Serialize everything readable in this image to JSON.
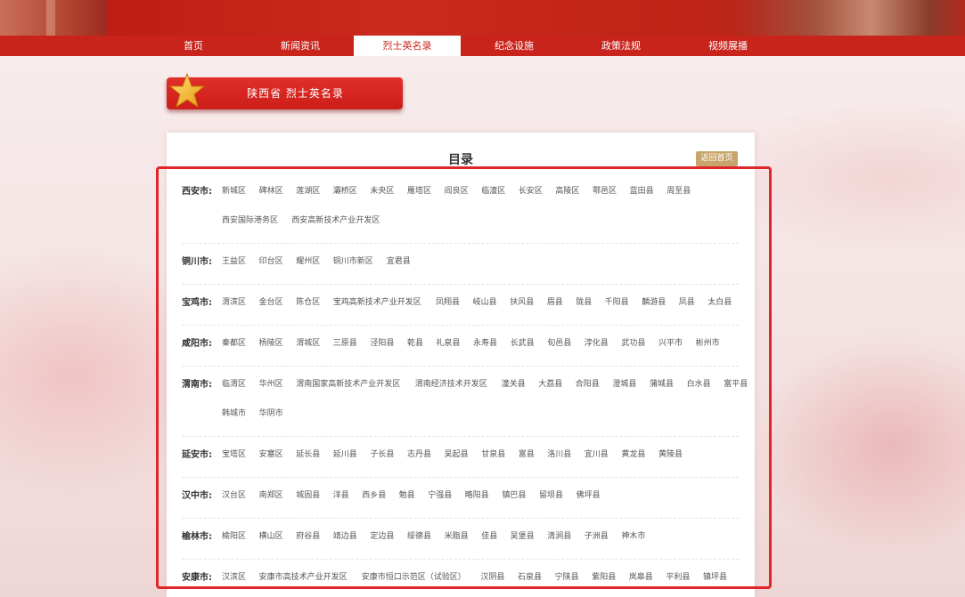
{
  "nav": {
    "items": [
      "首页",
      "新闻资讯",
      "烈士英名录",
      "纪念设施",
      "政策法规",
      "视频展播"
    ],
    "active_index": 2
  },
  "title_bar": {
    "text": "陕西省 烈士英名录"
  },
  "panel": {
    "title": "目录",
    "back_label": "返回首页"
  },
  "cities": [
    {
      "name": "西安市:",
      "districts": [
        [
          "新城区",
          "碑林区",
          "莲湖区",
          "灞桥区",
          "未央区",
          "雁塔区",
          "阎良区",
          "临潼区",
          "长安区",
          "高陵区",
          "鄠邑区",
          "蓝田县",
          "周至县"
        ],
        [
          "西安国际港务区",
          "西安高新技术产业开发区"
        ]
      ]
    },
    {
      "name": "铜川市:",
      "districts": [
        [
          "王益区",
          "印台区",
          "耀州区",
          "铜川市新区",
          "宜君县"
        ]
      ]
    },
    {
      "name": "宝鸡市:",
      "districts": [
        [
          "渭滨区",
          "金台区",
          "陈仓区",
          "宝鸡高新技术产业开发区",
          "凤翔县",
          "岐山县",
          "扶风县",
          "眉县",
          "陇县",
          "千阳县",
          "麟游县",
          "凤县",
          "太白县"
        ]
      ]
    },
    {
      "name": "咸阳市:",
      "districts": [
        [
          "秦都区",
          "杨陵区",
          "渭城区",
          "三原县",
          "泾阳县",
          "乾县",
          "礼泉县",
          "永寿县",
          "长武县",
          "旬邑县",
          "淳化县",
          "武功县",
          "兴平市",
          "彬州市"
        ]
      ]
    },
    {
      "name": "渭南市:",
      "districts": [
        [
          "临渭区",
          "华州区",
          "渭南国家高新技术产业开发区",
          "渭南经济技术开发区",
          "潼关县",
          "大荔县",
          "合阳县",
          "澄城县",
          "蒲城县",
          "白水县",
          "富平县"
        ],
        [
          "韩城市",
          "华阴市"
        ]
      ]
    },
    {
      "name": "延安市:",
      "districts": [
        [
          "宝塔区",
          "安塞区",
          "延长县",
          "延川县",
          "子长县",
          "志丹县",
          "吴起县",
          "甘泉县",
          "富县",
          "洛川县",
          "宜川县",
          "黄龙县",
          "黄陵县"
        ]
      ]
    },
    {
      "name": "汉中市:",
      "districts": [
        [
          "汉台区",
          "南郑区",
          "城固县",
          "洋县",
          "西乡县",
          "勉县",
          "宁强县",
          "略阳县",
          "镇巴县",
          "留坝县",
          "佛坪县"
        ]
      ]
    },
    {
      "name": "榆林市:",
      "districts": [
        [
          "榆阳区",
          "横山区",
          "府谷县",
          "靖边县",
          "定边县",
          "绥德县",
          "米脂县",
          "佳县",
          "吴堡县",
          "清涧县",
          "子洲县",
          "神木市"
        ]
      ]
    },
    {
      "name": "安康市:",
      "districts": [
        [
          "汉滨区",
          "安康市高技术产业开发区",
          "安康市恒口示范区（试验区）",
          "汉阴县",
          "石泉县",
          "宁陕县",
          "紫阳县",
          "岚皋县",
          "平利县",
          "镇坪县"
        ]
      ]
    }
  ],
  "colors": {
    "brand_red": "#c8241c",
    "back_button": "#c8a56a",
    "highlight": "#e0262a"
  }
}
